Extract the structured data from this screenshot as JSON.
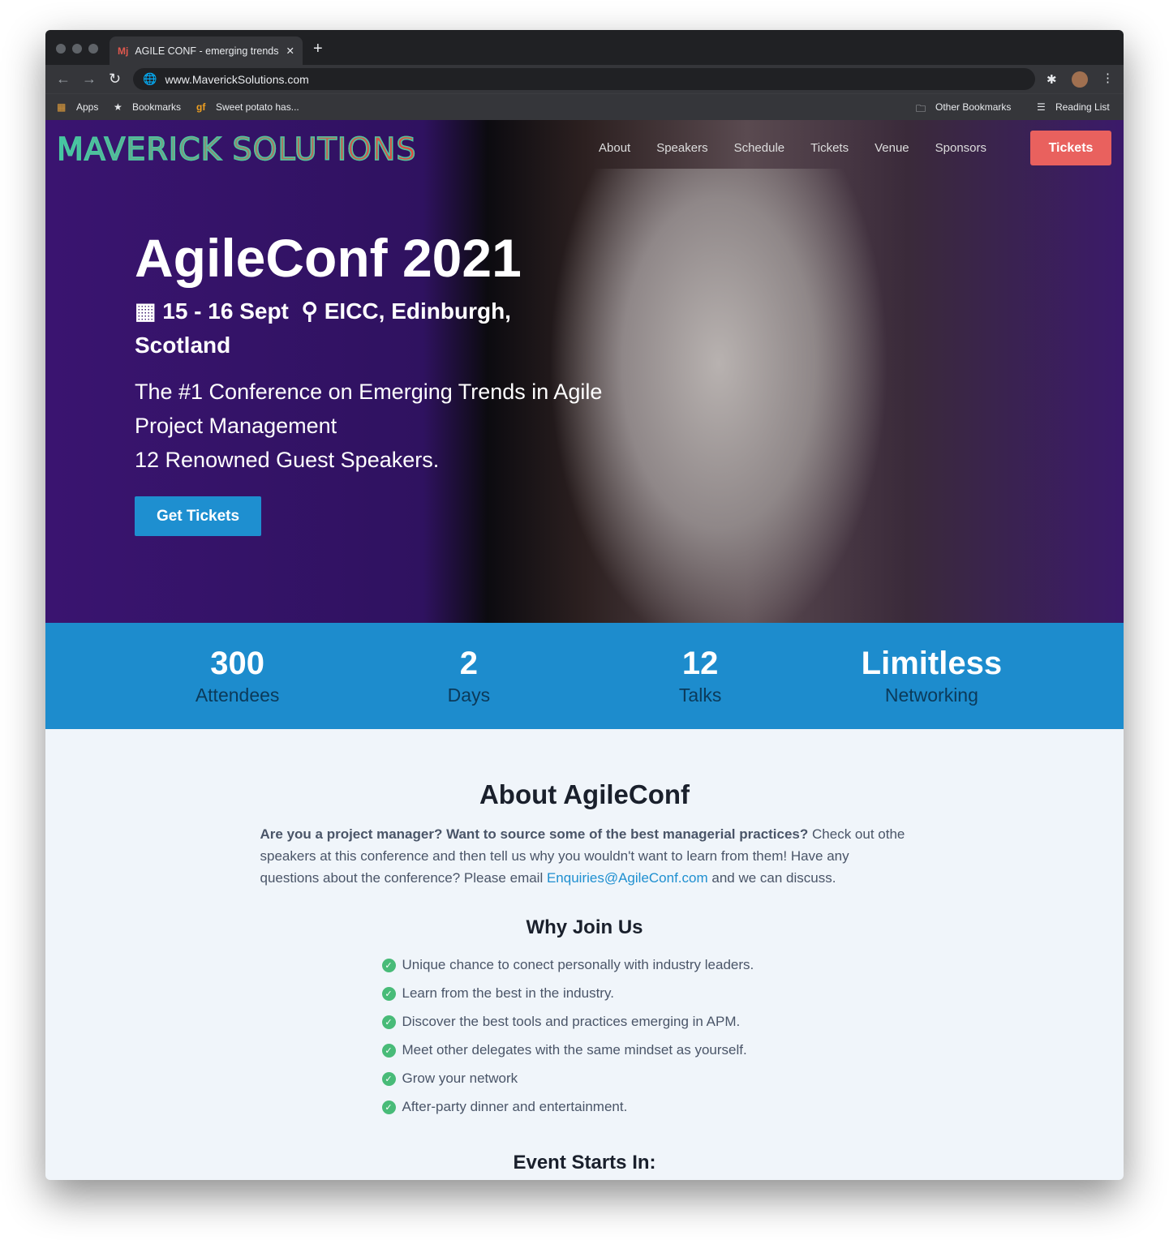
{
  "browser": {
    "tab_title": "AGILE CONF - emerging trends",
    "url": "www.MaverickSolutions.com",
    "bookmarks": [
      "Apps",
      "Bookmarks",
      "Sweet potato has..."
    ],
    "other_bookmarks": "Other Bookmarks",
    "reading_list": "Reading List"
  },
  "nav": {
    "logo": "MAVERICK SOLUTIONS",
    "items": [
      "About",
      "Speakers",
      "Schedule",
      "Tickets",
      "Venue",
      "Sponsors"
    ],
    "cta": "Tickets"
  },
  "hero": {
    "title": "AgileConf 2021",
    "dates": "15 - 16 Sept",
    "location": "EICC, Edinburgh, Scotland",
    "line1": "The #1 Conference on Emerging Trends in Agile Project Management",
    "line2": "12 Renowned Guest Speakers.",
    "button": "Get Tickets"
  },
  "stats": [
    {
      "n": "300",
      "l": "Attendees"
    },
    {
      "n": "2",
      "l": "Days"
    },
    {
      "n": "12",
      "l": "Talks"
    },
    {
      "n": "Limitless",
      "l": "Networking"
    }
  ],
  "about": {
    "title": "About AgileConf",
    "bold": "Are you a project manager? Want to source some of the best managerial practices?",
    "text1": " Check out othe speakers at this conference and then tell us why you wouldn't want to learn from them! Have any questions about the conference? Please email ",
    "email": "Enquiries@AgileConf.com",
    "text2": " and we can discuss.",
    "why": "Why Join Us",
    "reasons": [
      "Unique chance to conect personally with industry leaders.",
      "Learn from the best in the industry.",
      "Discover the best tools and practices emerging in APM.",
      "Meet other delegates with the same mindset as yourself.",
      "Grow your network",
      "After-party dinner and entertainment."
    ],
    "starts": "Event Starts In:"
  }
}
